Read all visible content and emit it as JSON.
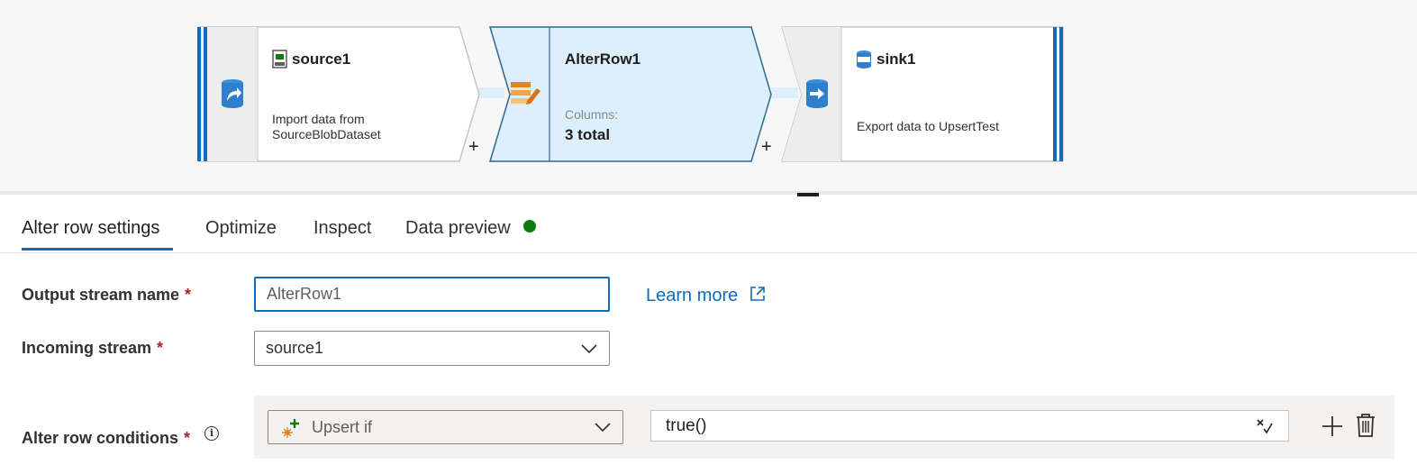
{
  "flow": {
    "source": {
      "title": "source1",
      "desc_line1": "Import data from",
      "desc_line2": "SourceBlobDataset",
      "icon": "csv-file-icon"
    },
    "alter": {
      "title": "AlterRow1",
      "columns_label": "Columns:",
      "columns_total": "3 total",
      "icon": "alter-row-icon"
    },
    "sink": {
      "title": "sink1",
      "desc": "Export data to UpsertTest",
      "icon": "sql-database-icon"
    },
    "add_label": "+"
  },
  "tabs": [
    {
      "label": "Alter row settings",
      "active": true
    },
    {
      "label": "Optimize"
    },
    {
      "label": "Inspect"
    },
    {
      "label": "Data preview",
      "status_color": "#107c10"
    }
  ],
  "form": {
    "output_stream": {
      "label": "Output stream name",
      "value": "AlterRow1"
    },
    "required_mark": "*",
    "learn_more": "Learn more",
    "incoming_stream": {
      "label": "Incoming stream",
      "value": "source1"
    },
    "conditions": {
      "label": "Alter row conditions",
      "type": "Upsert if",
      "expression": "true()"
    }
  },
  "colors": {
    "accent": "#0f6cbd",
    "node_selected": "#ddeefc",
    "status_ok": "#107c10"
  }
}
